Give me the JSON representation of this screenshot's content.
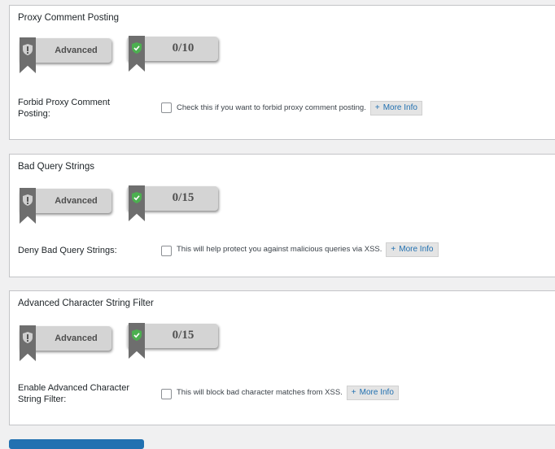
{
  "sections": [
    {
      "title": "Proxy Comment Posting",
      "level": "Advanced",
      "score": "0/10",
      "field_label": "Forbid Proxy Comment Posting:",
      "description": "Check this if you want to forbid proxy comment posting.",
      "checked": false,
      "more_info": "More Info"
    },
    {
      "title": "Bad Query Strings",
      "level": "Advanced",
      "score": "0/15",
      "field_label": "Deny Bad Query Strings:",
      "description": "This will help protect you against malicious queries via XSS.",
      "checked": false,
      "more_info": "More Info"
    },
    {
      "title": "Advanced Character String Filter",
      "level": "Advanced",
      "score": "0/15",
      "field_label": "Enable Advanced Character String Filter:",
      "description": "This will block bad character matches from XSS.",
      "checked": false,
      "more_info": "More Info"
    }
  ],
  "more_info_prefix": "+",
  "icons": {
    "level_icon": "shield-exclamation-icon",
    "score_icon": "shield-check-icon",
    "ribbon_color": "#6e6e6e",
    "check_color": "#4caf50"
  },
  "accent_color": "#2271b1"
}
